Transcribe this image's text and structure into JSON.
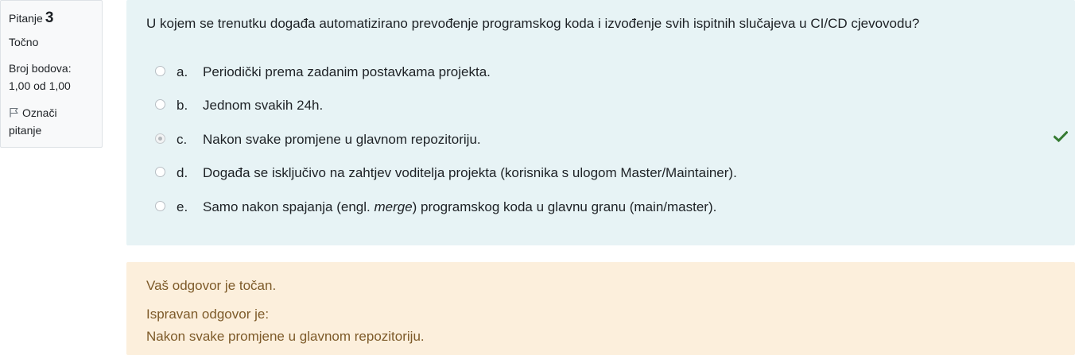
{
  "info": {
    "question_label": "Pitanje",
    "question_number": "3",
    "state": "Točno",
    "grade_label": "Broj bodova:",
    "grade_value": "1,00 od 1,00",
    "flag_label_line1": "Označi",
    "flag_label_line2": "pitanje"
  },
  "question": {
    "text": "U kojem se trenutku događa automatizirano prevođenje programskog koda i izvođenje svih ispitnih slučajeva u CI/CD cjevovodu?",
    "answers": [
      {
        "letter": "a.",
        "text": "Periodički prema zadanim postavkama projekta.",
        "selected": false
      },
      {
        "letter": "b.",
        "text": "Jednom svakih 24h.",
        "selected": false
      },
      {
        "letter": "c.",
        "text": "Nakon svake promjene u glavnom repozitoriju.",
        "selected": true,
        "correct": true
      },
      {
        "letter": "d.",
        "text": "Događa se isključivo na zahtjev voditelja projekta (korisnika s ulogom Master/Maintainer).",
        "selected": false
      },
      {
        "letter": "e.",
        "text_before": "Samo nakon spajanja (engl. ",
        "text_italic": "merge",
        "text_after": ") programskog koda u glavnu granu (main/master).",
        "selected": false
      }
    ]
  },
  "feedback": {
    "result": "Vaš odgovor je točan.",
    "right_answer_label": "Ispravan odgovor je:",
    "right_answer": "Nakon svake promjene u glavnom repozitoriju."
  },
  "colors": {
    "formulation_bg": "#e7f3f5",
    "feedback_bg": "#fcefdc",
    "feedback_text": "#7d5a29",
    "correct_icon": "#357a32"
  }
}
